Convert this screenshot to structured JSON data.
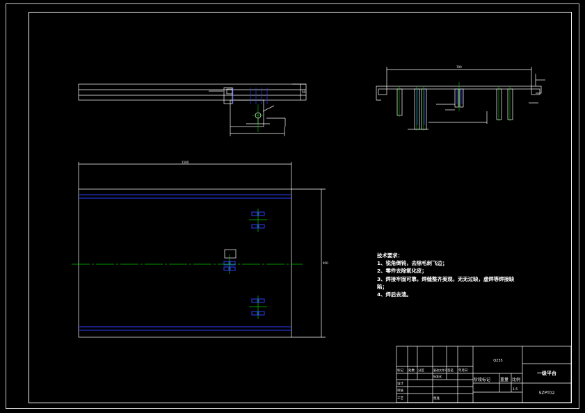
{
  "drawing": {
    "title": "一级平台",
    "drawing_number": "SZPT02",
    "material": "Q235"
  },
  "colors": {
    "background": "#000000",
    "outline": "#ffffff",
    "hidden_lines": "#2b3bff",
    "center_lines": "#00c800"
  },
  "technical_requirements": {
    "heading": "技术要求：",
    "items": [
      "1、锐角倒钝，去除毛刺飞边；",
      "2、零件去除氧化皮；",
      "3、焊接牢固可靠，焊缝整齐美观，无无过缺，虚焊等焊接缺",
      "陷；",
      "4、焊后去渣。"
    ]
  },
  "title_block": {
    "cells": [
      "标记",
      "处数",
      "分区",
      "更改文件号",
      "签名",
      "年月日"
    ],
    "stage_labels": [
      "阶段标记",
      "重量",
      "比例"
    ],
    "scale": "1:5",
    "roles": [
      "设计",
      "标准化",
      "审核",
      "工艺",
      "批准"
    ]
  },
  "dimensions": {
    "top_overall": "700",
    "plan_width": "1500",
    "front_height": "50",
    "plan_depth": "950"
  }
}
